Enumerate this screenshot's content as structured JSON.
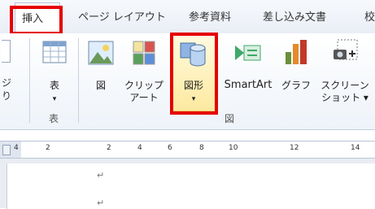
{
  "tabs": {
    "insert": "挿入",
    "page_layout": "ページ レイアウト",
    "references": "参考資料",
    "mailings": "差し込み文書",
    "review_partial": "校"
  },
  "ribbon": {
    "left_partial": {
      "line1": "ジ",
      "line2": "り"
    },
    "table": {
      "label": "表",
      "arrow": "▾",
      "group_label": "表"
    },
    "illustrations": {
      "picture": "図",
      "clipart_line1": "クリップ",
      "clipart_line2": "アート",
      "shapes": "図形",
      "shapes_arrow": "▾",
      "smartart": "SmartArt",
      "chart": "グラフ",
      "screenshot_line1": "スクリーン",
      "screenshot_line2": "ショット ▾",
      "group_label": "図"
    }
  },
  "ruler": {
    "marks": [
      "4",
      "2",
      "2",
      "4",
      "6",
      "8",
      "10",
      "12",
      "14"
    ]
  },
  "document": {
    "paragraph_mark": "↵"
  },
  "colors": {
    "highlight": "#e60000",
    "ribbon_border": "#b9c6d8"
  }
}
